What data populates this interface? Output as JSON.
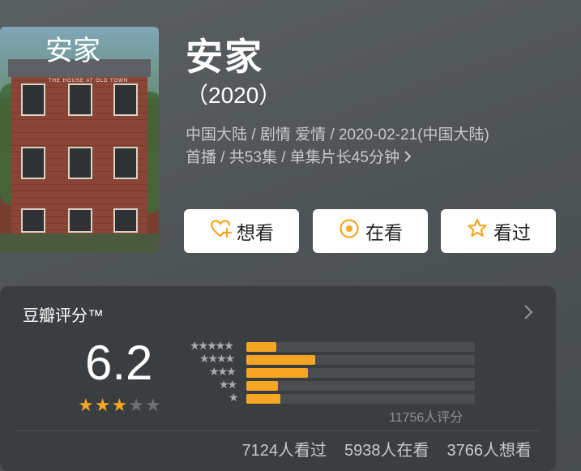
{
  "show": {
    "title": "安家",
    "year": "（2020）",
    "meta_line1": "中国大陆 / 剧情 爱情 / 2020-02-21(中国大陆)",
    "meta_line2": "首播 / 共53集 / 单集片长45分钟",
    "poster_title": "安家",
    "poster_subtitle": "THE HOUSE AT OLD TOWN"
  },
  "actions": {
    "want_label": "想看",
    "watching_label": "在看",
    "watched_label": "看过"
  },
  "rating": {
    "label": "豆瓣评分™",
    "score": "6.2",
    "stars_filled": 3,
    "stars_total": 5,
    "distribution": [
      {
        "stars": 5,
        "fraction": 0.13
      },
      {
        "stars": 4,
        "fraction": 0.3
      },
      {
        "stars": 3,
        "fraction": 0.27
      },
      {
        "stars": 2,
        "fraction": 0.14
      },
      {
        "stars": 1,
        "fraction": 0.15
      }
    ],
    "count": "11756人评分",
    "watched": "7124人看过",
    "watching": "5938人在看",
    "want": "3766人想看"
  },
  "colors": {
    "accent": "#f6a623",
    "button_bg": "#ffffff",
    "card_bg": "#3a3e40"
  },
  "icons": {
    "want": "heart-plus-icon",
    "watching": "target-circle-icon",
    "watched": "star-outline-icon",
    "more": "chevron-right-icon"
  }
}
